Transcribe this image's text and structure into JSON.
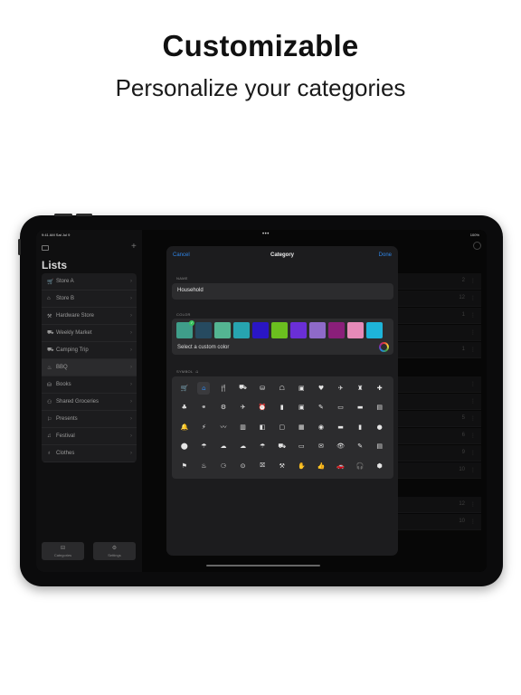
{
  "headline": {
    "title": "Customizable",
    "subtitle": "Personalize your categories"
  },
  "status_bar": {
    "time": "9:41 AM  Sat Jul 9",
    "dots": "•••",
    "battery": "100%"
  },
  "sidebar": {
    "title": "Lists",
    "items": [
      {
        "icon": "🛒",
        "label": "Store A"
      },
      {
        "icon": "⌂",
        "label": "Store B"
      },
      {
        "icon": "⚒",
        "label": "Hardware Store"
      },
      {
        "icon": "⛟",
        "label": "Weekly Market"
      },
      {
        "icon": "⛟",
        "label": "Camping Trip"
      },
      {
        "icon": "♨",
        "label": "BBQ"
      },
      {
        "icon": "⛁",
        "label": "Books"
      },
      {
        "icon": "⚇",
        "label": "Shared Groceries"
      },
      {
        "icon": "⚐",
        "label": "Presents"
      },
      {
        "icon": "♫",
        "label": "Festival"
      },
      {
        "icon": "♁",
        "label": "Clothes"
      }
    ],
    "active_index": 5,
    "bottom_buttons": [
      {
        "icon": "⊟",
        "label": "Categories"
      },
      {
        "icon": "⚙",
        "label": "Settings"
      }
    ]
  },
  "main": {
    "rows": [
      {
        "num": "2"
      },
      {
        "num": "12"
      },
      {
        "num": "1"
      },
      {
        "num": ""
      },
      {
        "num": "1"
      },
      {
        "num": ""
      },
      {
        "num": ""
      },
      {
        "num": "5"
      },
      {
        "num": "6"
      },
      {
        "num": "9"
      },
      {
        "num": "10"
      },
      {
        "num": "12"
      },
      {
        "num": "10"
      }
    ]
  },
  "modal": {
    "cancel": "Cancel",
    "title": "Category",
    "done": "Done",
    "name_label": "NAME",
    "name_value": "Household",
    "color_label": "COLOR",
    "swatches": [
      "#3f9e8a",
      "#264a60",
      "#54b592",
      "#27a4b0",
      "#2a16c4",
      "#6bbf1f",
      "#6a2fd6",
      "#8e6ac8",
      "#8a1f7a",
      "#e68ab8",
      "#1eb4d9"
    ],
    "selected_swatch": 0,
    "custom_color_label": "Select a custom color",
    "symbol_label": "SYMBOL",
    "symbols": [
      "🛒",
      "⌂",
      "🍴",
      "⛟",
      "⛁",
      "☖",
      "▣",
      "♥",
      "✈",
      "♜",
      "✚",
      "♣",
      "⚭",
      "⚙",
      "✈",
      "⏰",
      "▮",
      "▣",
      "✎",
      "▭",
      "▬",
      "▤",
      "🔔",
      "⚡",
      "〰",
      "▥",
      "◧",
      "▢",
      "▦",
      "◉",
      "▬",
      "▮",
      "●",
      "⬤",
      "☂",
      "☁",
      "☁",
      "☂",
      "⛟",
      "▭",
      "✉",
      "👁",
      "✎",
      "▤",
      "⚑",
      "♨",
      "⚆",
      "⊙",
      "⛝",
      "⚒",
      "✋",
      "👍",
      "🚗",
      "🎧",
      "⬢"
    ],
    "selected_symbol": 1
  },
  "colors": {
    "accent": "#2f86e8",
    "background": "#1c1c1e",
    "field": "#2c2c2e"
  }
}
